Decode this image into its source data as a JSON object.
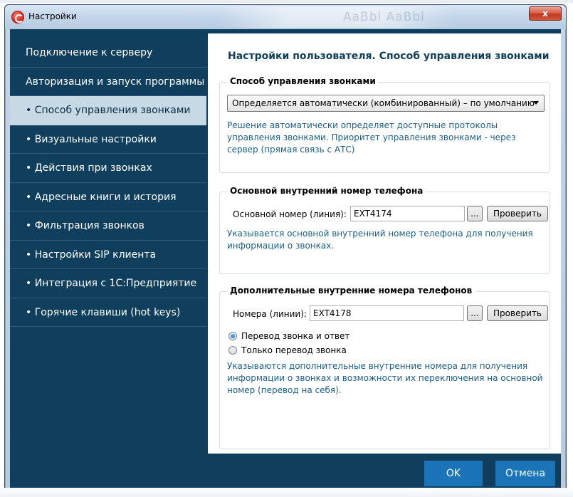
{
  "window": {
    "title": "Настройки",
    "close_label": "x",
    "title_ghost_text": "AaBbl AaBbl"
  },
  "sidebar": {
    "items": [
      {
        "label": "Подключение к серверу",
        "active": false
      },
      {
        "label": "Авторизация и запуск программы",
        "active": false
      },
      {
        "label": "• Способ управления звонками",
        "active": true
      },
      {
        "label": "• Визуальные настройки",
        "active": false
      },
      {
        "label": "• Действия при звонках",
        "active": false
      },
      {
        "label": "• Адресные книги и история",
        "active": false
      },
      {
        "label": "• Фильтрация звонков",
        "active": false
      },
      {
        "label": "• Настройки SIP клиента",
        "active": false
      },
      {
        "label": "• Интеграция с 1С:Предприятие",
        "active": false
      },
      {
        "label": "• Горячие клавиши (hot keys)",
        "active": false
      }
    ]
  },
  "panel": {
    "title": "Настройки пользователя. Способ управления звонками",
    "call_control": {
      "group_title": "Способ управления звонками",
      "selected": "Определяется автоматически (комбинированный) – по умолчанию",
      "description": "Решение автоматически определяет доступные протоколы управления звонками. Приоритет управления звонками - через сервер (прямая связь с АТС)"
    },
    "main_number": {
      "group_title": "Основной внутренний номер телефона",
      "field_label": "Основной номер (линия):",
      "value": "EXT4174",
      "browse_label": "...",
      "check_label": "Проверить",
      "description": "Указывается основной внутренний номер телефона для получения информации о звонках."
    },
    "extra_numbers": {
      "group_title": "Дополнительные внутренние номера телефонов",
      "field_label": "Номера (линии):",
      "value": "EXT4178",
      "browse_label": "...",
      "check_label": "Проверить",
      "radio_options": [
        {
          "label": "Перевод звонка и ответ",
          "selected": true
        },
        {
          "label": "Только перевод звонка",
          "selected": false
        }
      ],
      "description": "Указываются дополнительные внутренние номера для получения информации о звонках и возможности их переключения на основной номер (перевод на себя)."
    }
  },
  "footer": {
    "ok_label": "OK",
    "cancel_label": "Отмена"
  },
  "colors": {
    "sidebar_bg": "#0f3f5c",
    "active_item_bg": "#c8d9e6",
    "accent_button": "#1b74b8",
    "description_text": "#1b5f8c"
  }
}
